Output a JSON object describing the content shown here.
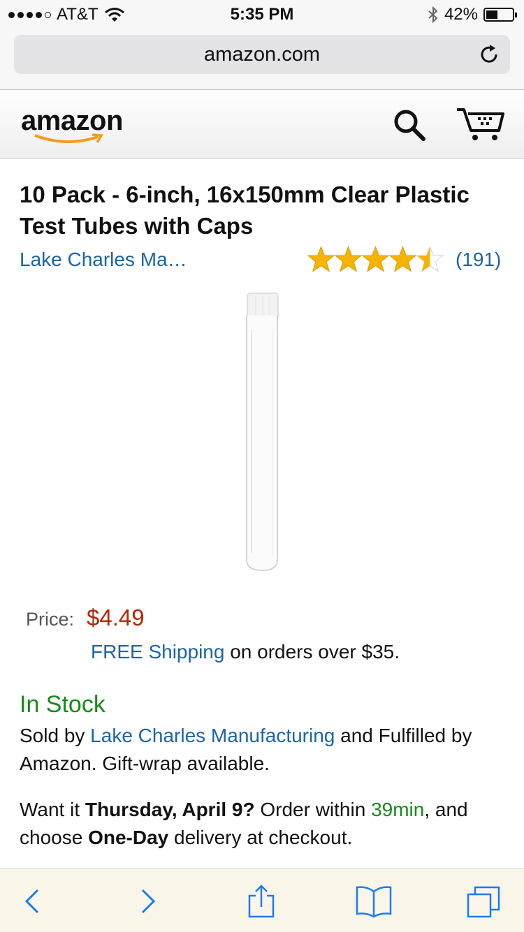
{
  "status_bar": {
    "carrier": "AT&T",
    "time": "5:35 PM",
    "battery": "42%"
  },
  "browser": {
    "url": "amazon.com"
  },
  "header": {
    "logo": "amazon"
  },
  "product": {
    "title": "10 Pack - 6-inch, 16x150mm Clear Plastic Test Tubes with Caps",
    "brand": "Lake Charles Ma…",
    "rating": 4.5,
    "review_count": "(191)",
    "price_label": "Price:",
    "price": "$4.49",
    "shipping_link": "FREE Shipping",
    "shipping_text": " on orders over $35.",
    "stock": "In Stock",
    "sold_by_prefix": "Sold by ",
    "seller": "Lake Charles Manufacturing",
    "sold_by_suffix": " and Fulfilled by Amazon. Gift-wrap available.",
    "delivery_prefix": "Want it ",
    "delivery_date": "Thursday, April 9?",
    "delivery_mid": " Order within ",
    "delivery_time": "39min",
    "delivery_mid2": ", and choose ",
    "delivery_option": "One-Day",
    "delivery_suffix": " delivery at checkout."
  },
  "colors": {
    "link": "#1d64a8",
    "price": "#b12704",
    "stock": "#178a1b",
    "star": "#f4b400"
  },
  "icons": [
    "signal-icon",
    "wifi-icon",
    "bluetooth-icon",
    "battery-icon",
    "reload-icon",
    "search-icon",
    "cart-icon",
    "back-icon",
    "forward-icon",
    "share-icon",
    "bookmarks-icon",
    "tabs-icon"
  ]
}
